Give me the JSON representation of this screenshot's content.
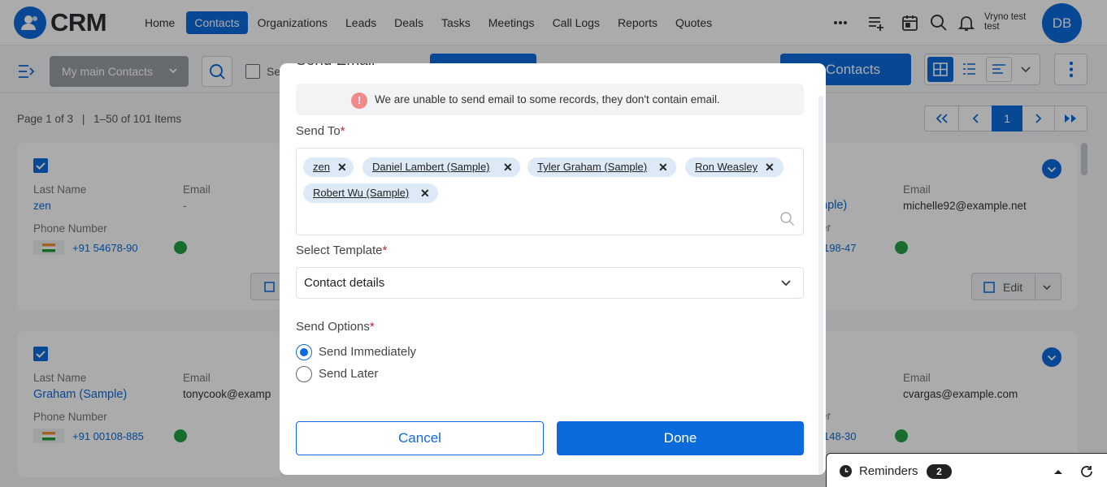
{
  "app": {
    "logo_text": "CRM"
  },
  "nav": {
    "items": [
      {
        "label": "Home"
      },
      {
        "label": "Contacts"
      },
      {
        "label": "Organizations"
      },
      {
        "label": "Leads"
      },
      {
        "label": "Deals"
      },
      {
        "label": "Tasks"
      },
      {
        "label": "Meetings"
      },
      {
        "label": "Call Logs"
      },
      {
        "label": "Reports"
      },
      {
        "label": "Quotes"
      }
    ],
    "active": "Contacts"
  },
  "user": {
    "name_line1": "Vryno test",
    "name_line2": "test",
    "initials": "DB"
  },
  "toolbar": {
    "view_select": "My main Contacts",
    "select_all_partial": "Se",
    "add_button_partial": "Contacts",
    "modal_title_partial": "Send Email"
  },
  "pagination": {
    "summary": "Page 1 of 3",
    "items": "1–50 of 101 Items",
    "current_page": "1"
  },
  "cards": [
    {
      "last_name_label": "Last Name",
      "last_name": "zen",
      "email_label": "Email",
      "email": "-",
      "phone_label": "Phone Number",
      "phone": "+91 54678-90"
    },
    {
      "email_label": "Email",
      "email": "michelle92@example.net",
      "last_name_partial": "nple)",
      "phone_label_partial": "er",
      "phone_partial": "198-47",
      "edit_label": "Edit"
    },
    {
      "last_name_label": "Last Name",
      "last_name": "Graham (Sample)",
      "email_label": "Email",
      "email": "tonycook@examp",
      "phone_label": "Phone Number",
      "phone": "+91 00108-885"
    },
    {
      "email_label": "Email",
      "email": "cvargas@example.com",
      "phone_label_partial": "er",
      "phone_partial": "148-30"
    }
  ],
  "modal": {
    "alert": "We are unable to send email to some records, they don't contain email.",
    "send_to_label": "Send To",
    "recipients": [
      "zen",
      "Daniel Lambert (Sample)",
      "Tyler Graham (Sample)",
      "Ron Weasley",
      "Robert Wu (Sample)"
    ],
    "template_label": "Select Template",
    "template_value": "Contact details",
    "send_options_label": "Send Options",
    "options": [
      "Send Immediately",
      "Send Later"
    ],
    "selected_option": "Send Immediately",
    "cancel": "Cancel",
    "done": "Done"
  },
  "reminders": {
    "label": "Reminders",
    "count": "2"
  },
  "colors": {
    "accent": "#0b6bdc",
    "whatsapp": "#25a244",
    "required": "#c0262d"
  }
}
